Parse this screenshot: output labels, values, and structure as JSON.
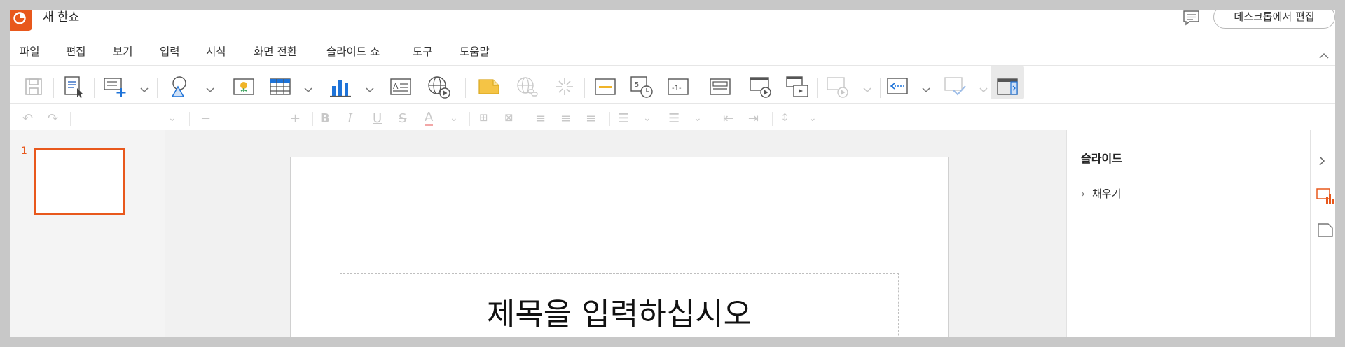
{
  "app": {
    "title": "새 한쇼",
    "desktop_button": "데스크톱에서 편집",
    "accent": "#e8581c"
  },
  "menu": {
    "items": [
      "파일",
      "편집",
      "보기",
      "입력",
      "서식",
      "화면 전환",
      "슬라이드 쇼",
      "도구",
      "도움말"
    ]
  },
  "toolbar": {
    "icons": [
      "save-icon",
      "select-icon",
      "new-slide-icon",
      "shape-icon",
      "picture-icon",
      "table-icon",
      "chart-icon",
      "textbox-icon",
      "web-video-icon",
      "memo-icon",
      "hyperlink-icon",
      "slide-effect-icon",
      "header-footer-icon",
      "date-time-icon",
      "slide-number-icon",
      "slide-layout-icon",
      "slideshow-icon",
      "slide-sorter-icon",
      "transition-icon",
      "animation-back-icon",
      "check-icon",
      "side-panel-icon"
    ]
  },
  "thumbnails": {
    "items": [
      {
        "number": "1"
      }
    ]
  },
  "slide": {
    "title_placeholder": "제목을 입력하십시오"
  },
  "properties": {
    "title": "슬라이드",
    "fill_label": "채우기"
  }
}
